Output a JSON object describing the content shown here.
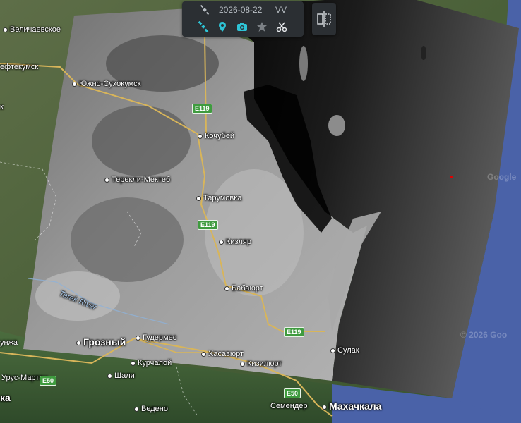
{
  "toolbar": {
    "date": "2026-08-22",
    "polarization": "VV",
    "accent_color": "#2ec4d6"
  },
  "map": {
    "watermarks": [
      "Google",
      "© 2026 Goo"
    ],
    "places": [
      {
        "id": "velichaevskoe",
        "name": "Величаевское"
      },
      {
        "id": "neftekumsk",
        "name": "ефтекумск"
      },
      {
        "id": "yuzhno-sukhokumsk",
        "name": "Южно-Сухокумск"
      },
      {
        "id": "kochubei",
        "name": "Кочубей"
      },
      {
        "id": "terekli-mekteb",
        "name": "Терекли-Мектеб"
      },
      {
        "id": "tarumovka",
        "name": "Тарумовка"
      },
      {
        "id": "kizlyar",
        "name": "Кизляр"
      },
      {
        "id": "babayurt",
        "name": "Бабаюрт"
      },
      {
        "id": "grozny",
        "name": "Грозный"
      },
      {
        "id": "gudermes",
        "name": "Гудермес"
      },
      {
        "id": "khasavyurt",
        "name": "Хасавюрт"
      },
      {
        "id": "kurchaloy",
        "name": "Курчалой"
      },
      {
        "id": "kizilyurt",
        "name": "Кизилюрт"
      },
      {
        "id": "sulak",
        "name": "Сулак"
      },
      {
        "id": "urus-martan",
        "name": "Урус-Мартан"
      },
      {
        "id": "shali",
        "name": "Шали"
      },
      {
        "id": "vedeno",
        "name": "Ведено"
      },
      {
        "id": "semender",
        "name": "Семендер"
      },
      {
        "id": "makhachkala",
        "name": "Махачкала"
      },
      {
        "id": "unzha",
        "name": "унжа"
      },
      {
        "id": "ka",
        "name": "ка"
      },
      {
        "id": "k",
        "name": "к"
      }
    ],
    "river": "Terek River",
    "roads": [
      "E119",
      "E119",
      "E119",
      "E50",
      "E50"
    ]
  }
}
